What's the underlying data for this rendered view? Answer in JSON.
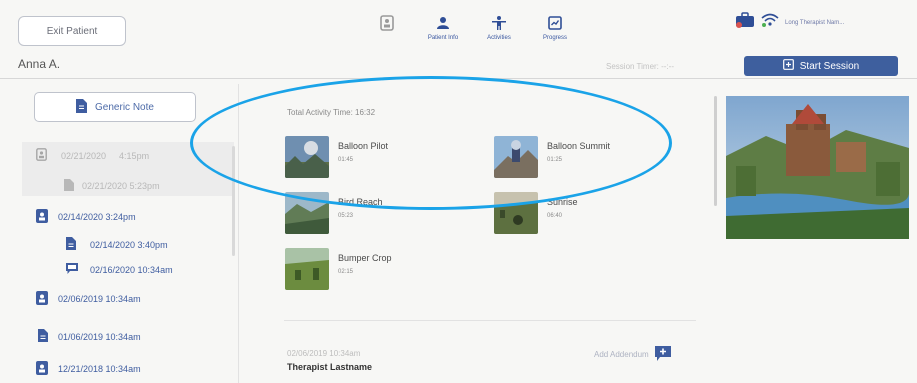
{
  "header": {
    "exit_label": "Exit Patient",
    "patient_name": "Anna A.",
    "nav": [
      {
        "label": "",
        "icon": "id-badge-icon"
      },
      {
        "label": "Patient Info",
        "icon": "patient-info-icon"
      },
      {
        "label": "Activities",
        "icon": "activities-icon"
      },
      {
        "label": "Progress",
        "icon": "progress-icon"
      }
    ],
    "therapist_name": "Long Therapist Nam...",
    "session_timer": "Session Timer: --:--",
    "start_session_label": "Start Session"
  },
  "sidebar": {
    "generic_note_label": "Generic Note",
    "entries": [
      {
        "date": "02/21/2020",
        "time": "4:15pm",
        "icon": "id-badge-icon"
      },
      {
        "date": "02/21/2020 5:23pm",
        "icon": "document-icon"
      },
      {
        "date": "02/14/2020 3:24pm",
        "icon": "id-badge-icon"
      },
      {
        "date": "02/14/2020  3:40pm",
        "icon": "document-icon"
      },
      {
        "date": "02/16/2020 10:34am",
        "icon": "chat-icon"
      },
      {
        "date": "02/06/2019 10:34am",
        "icon": "id-badge-icon"
      },
      {
        "date": "01/06/2019 10:34am",
        "icon": "document-icon"
      },
      {
        "date": "12/21/2018 10:34am",
        "icon": "id-badge-icon"
      }
    ]
  },
  "main": {
    "total_activity_time": "Total Activity Time: 16:32",
    "activities": [
      {
        "name": "Balloon Pilot",
        "time": "01:45"
      },
      {
        "name": "Balloon Summit",
        "time": "01:25"
      },
      {
        "name": "Bird Reach",
        "time": "05:23"
      },
      {
        "name": "Sunrise",
        "time": "06:40"
      },
      {
        "name": "Bumper Crop",
        "time": "02:15"
      }
    ],
    "note_date": "02/06/2019 10:34am",
    "note_author": "Therapist Lastname",
    "add_addendum_label": "Add Addendum"
  },
  "colors": {
    "accent": "#3e5f9e",
    "link": "#3f5da0",
    "highlight_ring": "#1aa3e8",
    "background": "#f7f7f5"
  }
}
